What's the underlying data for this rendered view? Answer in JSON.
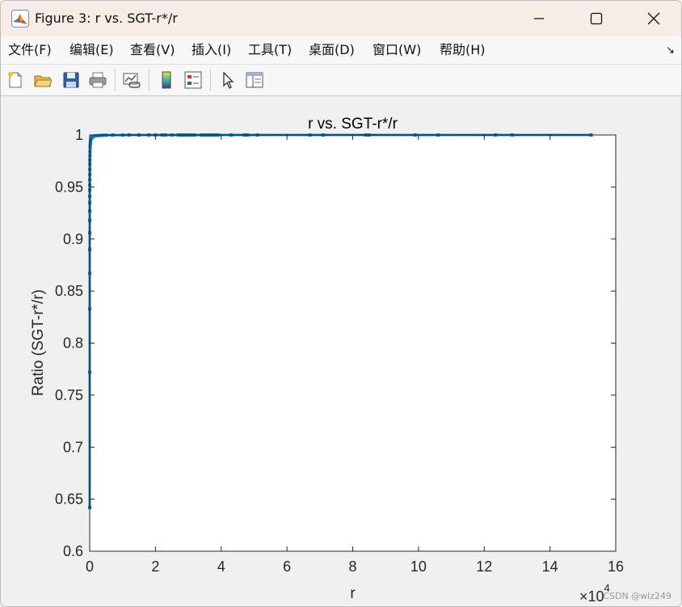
{
  "window": {
    "title": "Figure 3: r vs. SGT-r*/r",
    "icon": "matlab-icon",
    "controls": [
      "minimize-icon",
      "maximize-icon",
      "close-icon"
    ]
  },
  "menu": {
    "items": [
      "文件(F)",
      "编辑(E)",
      "查看(V)",
      "插入(I)",
      "工具(T)",
      "桌面(D)",
      "窗口(W)",
      "帮助(H)"
    ],
    "overflow_glyph": "↘"
  },
  "toolbar": {
    "icons": [
      "new-figure-icon",
      "open-file-icon",
      "save-icon",
      "print-icon",
      "link-plot-icon",
      "colorbar-icon",
      "legend-icon",
      "pointer-icon",
      "property-editor-icon"
    ]
  },
  "watermark": "CSDN @wlz249",
  "chart_data": {
    "type": "scatter",
    "title": "r vs. SGT-r*/r",
    "xlabel": "r",
    "ylabel": "Ratio (SGT-r*/r)",
    "xlim": [
      0,
      160000
    ],
    "ylim": [
      0.6,
      1.0
    ],
    "x_ticks": [
      0,
      20000,
      40000,
      60000,
      80000,
      100000,
      120000,
      140000,
      160000
    ],
    "x_tick_labels": [
      "0",
      "2",
      "4",
      "6",
      "8",
      "10",
      "12",
      "14",
      "16"
    ],
    "x_exponent_label": "×10",
    "x_exponent_power": "4",
    "y_ticks": [
      0.6,
      0.65,
      0.7,
      0.75,
      0.8,
      0.85,
      0.9,
      0.95,
      1.0
    ],
    "y_tick_labels": [
      "0.6",
      "0.65",
      "0.7",
      "0.75",
      "0.8",
      "0.85",
      "0.9",
      "0.95",
      "1"
    ],
    "grid": false,
    "marker_color": "#0072bd",
    "series": [
      {
        "x": [
          1,
          2,
          3,
          4,
          5,
          6,
          7,
          8,
          10,
          12,
          15,
          20,
          25,
          30,
          40,
          50,
          60,
          80,
          100,
          130,
          160,
          200,
          250,
          300,
          400,
          500,
          700,
          1000,
          1500,
          2000,
          3000,
          4000,
          5000,
          7000,
          10000,
          12000,
          15000,
          18000,
          20000,
          22000,
          23000,
          25000,
          27000,
          28000,
          29000,
          30000,
          31000,
          32000,
          34000,
          35000,
          36000,
          37000,
          38000,
          39000,
          43000,
          47000,
          48000,
          51000,
          67000,
          71000,
          84000,
          85000,
          99000,
          106000,
          123500,
          128500,
          152500
        ],
        "y": [
          0.642,
          0.772,
          0.833,
          0.867,
          0.89,
          0.906,
          0.918,
          0.927,
          0.935,
          0.941,
          0.947,
          0.952,
          0.957,
          0.962,
          0.967,
          0.972,
          0.976,
          0.98,
          0.984,
          0.988,
          0.99,
          0.992,
          0.994,
          0.995,
          0.996,
          0.997,
          0.998,
          0.9985,
          0.999,
          0.9993,
          0.9995,
          0.9997,
          0.9998,
          0.9999,
          0.9999,
          1.0,
          1.0,
          1.0,
          1.0,
          1.0,
          1.0,
          1.0,
          1.0,
          1.0,
          1.0,
          1.0,
          1.0,
          1.0,
          1.0,
          1.0,
          1.0,
          1.0,
          1.0,
          1.0,
          1.0,
          1.0,
          1.0,
          1.0,
          1.0,
          1.0,
          1.0,
          1.0,
          1.0,
          1.0,
          1.0,
          1.0,
          1.0
        ]
      }
    ]
  }
}
